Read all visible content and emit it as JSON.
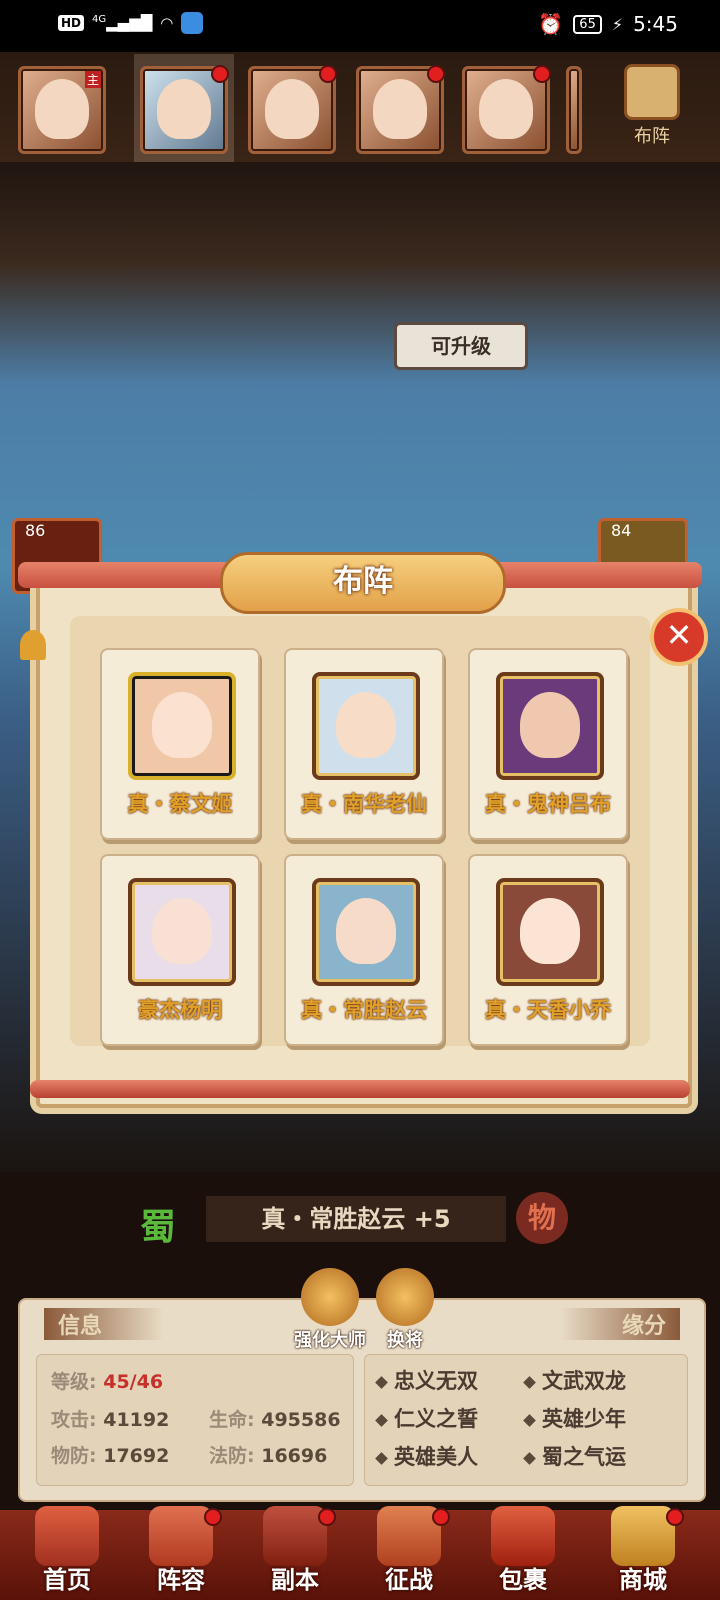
{
  "status_bar": {
    "network": "HD",
    "signal_label": "4G",
    "battery": "65",
    "time": "5:45"
  },
  "hero_strip": {
    "leader_badge": "主",
    "formation_label": "布阵"
  },
  "scene": {
    "upgrade_bubble": "可升级",
    "left_level": "86",
    "right_level": "84"
  },
  "modal": {
    "title": "布阵",
    "heroes": [
      {
        "name": "真・蔡文姬"
      },
      {
        "name": "真・南华老仙"
      },
      {
        "name": "真・鬼神吕布"
      },
      {
        "name": "豪杰杨明"
      },
      {
        "name": "真・常胜赵云"
      },
      {
        "name": "真・天香小乔"
      }
    ]
  },
  "hero_panel": {
    "faction": "蜀",
    "hero_name": "真・常胜赵云 +5",
    "damage_type": "物",
    "info_tab": "信息",
    "bond_tab": "缘分",
    "enhance_btn": "强化大师",
    "swap_btn": "换将",
    "stats": {
      "level_label": "等级:",
      "level_value": "45/46",
      "atk_label": "攻击:",
      "atk_value": "41192",
      "hp_label": "生命:",
      "hp_value": "495586",
      "pdef_label": "物防:",
      "pdef_value": "17692",
      "mdef_label": "法防:",
      "mdef_value": "16696"
    },
    "bonds": [
      "忠义无双",
      "文武双龙",
      "仁义之誓",
      "英雄少年",
      "英雄美人",
      "蜀之气运"
    ]
  },
  "bottom_nav": [
    "首页",
    "阵容",
    "副本",
    "征战",
    "包裹",
    "商城"
  ]
}
